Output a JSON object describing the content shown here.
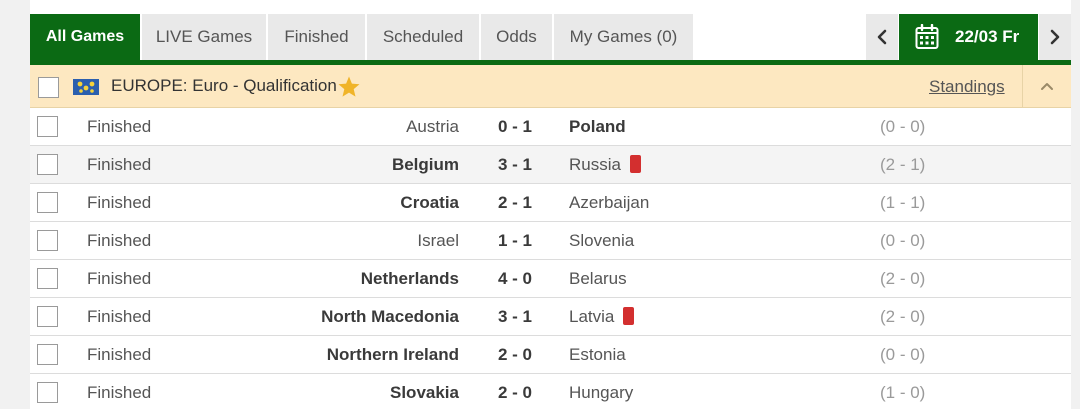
{
  "tabs": [
    {
      "label": "All Games",
      "active": true
    },
    {
      "label": "LIVE Games",
      "active": false
    },
    {
      "label": "Finished",
      "active": false
    },
    {
      "label": "Scheduled",
      "active": false
    },
    {
      "label": "Odds",
      "active": false
    },
    {
      "label": "My Games (0)",
      "active": false
    }
  ],
  "date_nav": {
    "prev_icon": "chevron-left-icon",
    "date_label": "22/03 Fr",
    "calendar_icon": "calendar-icon",
    "next_icon": "chevron-right-icon"
  },
  "league": {
    "name": "EUROPE: Euro - Qualification",
    "flag_icon": "europe-flag-icon",
    "favorite_icon": "star-icon",
    "standings_label": "Standings",
    "collapse_icon": "chevron-up-icon"
  },
  "matches": [
    {
      "status": "Finished",
      "home": "Austria",
      "score": "0 - 1",
      "away": "Poland",
      "halftime": "(0 - 0)",
      "winner": "away",
      "away_red_card": false
    },
    {
      "status": "Finished",
      "home": "Belgium",
      "score": "3 - 1",
      "away": "Russia",
      "halftime": "(2 - 1)",
      "winner": "home",
      "away_red_card": true
    },
    {
      "status": "Finished",
      "home": "Croatia",
      "score": "2 - 1",
      "away": "Azerbaijan",
      "halftime": "(1 - 1)",
      "winner": "home",
      "away_red_card": false
    },
    {
      "status": "Finished",
      "home": "Israel",
      "score": "1 - 1",
      "away": "Slovenia",
      "halftime": "(0 - 0)",
      "winner": "draw",
      "away_red_card": false
    },
    {
      "status": "Finished",
      "home": "Netherlands",
      "score": "4 - 0",
      "away": "Belarus",
      "halftime": "(2 - 0)",
      "winner": "home",
      "away_red_card": false
    },
    {
      "status": "Finished",
      "home": "North Macedonia",
      "score": "3 - 1",
      "away": "Latvia",
      "halftime": "(2 - 0)",
      "winner": "home",
      "away_red_card": true
    },
    {
      "status": "Finished",
      "home": "Northern Ireland",
      "score": "2 - 0",
      "away": "Estonia",
      "halftime": "(0 - 0)",
      "winner": "home",
      "away_red_card": false
    },
    {
      "status": "Finished",
      "home": "Slovakia",
      "score": "2 - 0",
      "away": "Hungary",
      "halftime": "(1 - 0)",
      "winner": "home",
      "away_red_card": false
    }
  ],
  "colors": {
    "accent_green": "#0b6a14",
    "league_bg": "#fde8c1",
    "red_card": "#d32f2f",
    "star": "#f0b429"
  }
}
